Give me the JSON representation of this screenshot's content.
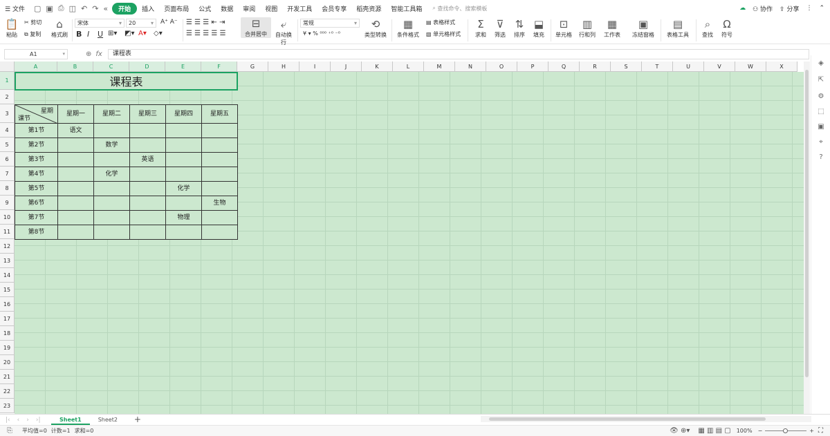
{
  "menubar": {
    "file": "文件",
    "tabs": [
      "开始",
      "插入",
      "页面布局",
      "公式",
      "数据",
      "审阅",
      "视图",
      "开发工具",
      "会员专享",
      "稻壳资源",
      "智能工具箱"
    ],
    "active_tab": "开始",
    "search_placeholder": "查找命令、搜索模板",
    "collab": "协作",
    "share": "分享"
  },
  "ribbon": {
    "paste": "粘贴",
    "cut": "剪切",
    "copy": "复制",
    "format_painter": "格式刷",
    "font_name": "宋体",
    "font_size": "20",
    "merge_center": "合并居中",
    "wrap": "自动换行",
    "number_format": "常规",
    "type_convert": "类型转换",
    "cond_format": "条件格式",
    "table_style": "表格样式",
    "cell_style": "单元格样式",
    "sum": "求和",
    "filter": "筛选",
    "sort": "排序",
    "fill": "填充",
    "cell": "单元格",
    "row_col": "行和列",
    "worksheet": "工作表",
    "freeze": "冻结窗格",
    "table_tools": "表格工具",
    "find": "查找",
    "symbol": "符号"
  },
  "formula_bar": {
    "cell_ref": "A1",
    "fx": "fx",
    "content": "课程表"
  },
  "columns": [
    "A",
    "B",
    "C",
    "D",
    "E",
    "F",
    "G",
    "H",
    "I",
    "J",
    "K",
    "L",
    "M",
    "N",
    "O",
    "P",
    "Q",
    "R",
    "S",
    "T",
    "U",
    "V",
    "W",
    "X"
  ],
  "rows": [
    "1",
    "2",
    "3",
    "4",
    "5",
    "6",
    "7",
    "8",
    "9",
    "10",
    "11",
    "12",
    "13",
    "14",
    "15",
    "16",
    "17",
    "18",
    "19",
    "20",
    "21",
    "22",
    "23"
  ],
  "schedule": {
    "title": "课程表",
    "corner_top": "星期",
    "corner_bottom": "课节",
    "days": [
      "星期一",
      "星期二",
      "星期三",
      "星期四",
      "星期五"
    ],
    "periods": [
      "第1节",
      "第2节",
      "第3节",
      "第4节",
      "第5节",
      "第6节",
      "第7节",
      "第8节"
    ],
    "cells": [
      [
        "语文",
        "",
        "",
        "",
        ""
      ],
      [
        "",
        "数学",
        "",
        "",
        ""
      ],
      [
        "",
        "",
        "英语",
        "",
        ""
      ],
      [
        "",
        "化学",
        "",
        "",
        ""
      ],
      [
        "",
        "",
        "",
        "化学",
        ""
      ],
      [
        "",
        "",
        "",
        "",
        "生物"
      ],
      [
        "",
        "",
        "",
        "物理",
        ""
      ],
      [
        "",
        "",
        "",
        "",
        ""
      ]
    ]
  },
  "sheets": [
    "Sheet1",
    "Sheet2"
  ],
  "active_sheet": "Sheet1",
  "status": {
    "avg": "平均值=0",
    "count": "计数=1",
    "sum": "求和=0",
    "zoom": "100%"
  }
}
